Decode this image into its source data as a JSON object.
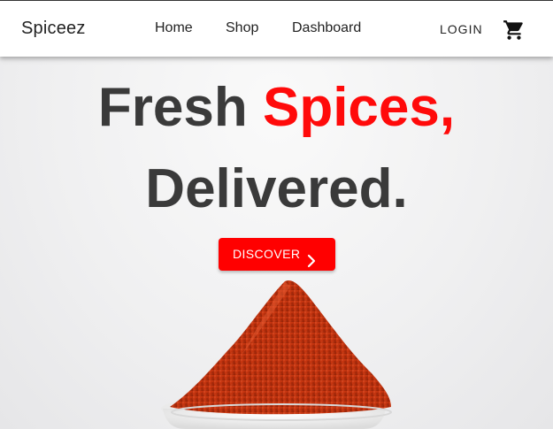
{
  "navbar": {
    "brand": "Spiceez",
    "links": [
      {
        "label": "Home"
      },
      {
        "label": "Shop"
      },
      {
        "label": "Dashboard"
      }
    ],
    "login_label": "LOGIN",
    "cart_icon": "shopping-cart-icon"
  },
  "hero": {
    "headline_part1": "Fresh ",
    "headline_accent": "Spices,",
    "headline_line2": "Delivered.",
    "accent_color": "#ff0a0a",
    "text_color": "#3a3a3a",
    "cta_label": "DISCOVER",
    "cta_icon": "chevron-right-icon",
    "cta_color": "#ff0000",
    "image": "red-chili-powder-bowl"
  }
}
